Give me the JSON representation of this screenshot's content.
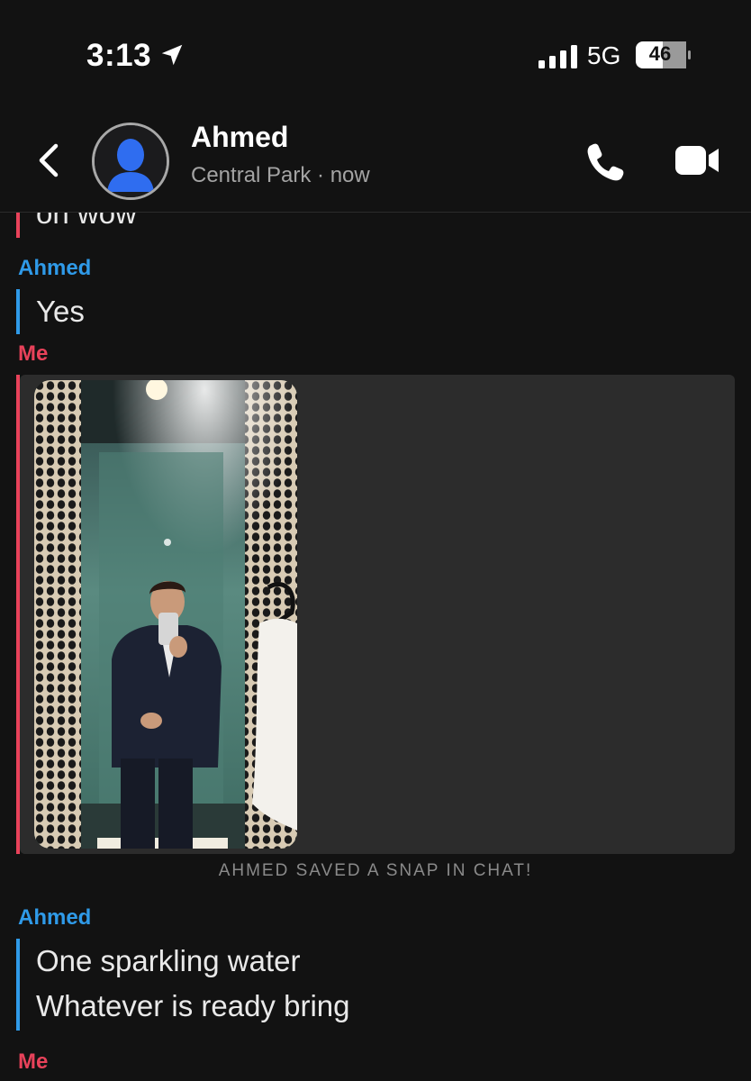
{
  "status_bar": {
    "time": "3:13",
    "network": "5G",
    "battery": "46",
    "location_icon": "location-arrow-icon",
    "signal_icon": "cellular-signal-icon"
  },
  "header": {
    "contact_name": "Ahmed",
    "subtitle": "Central Park · now",
    "back_icon": "chevron-left-icon",
    "call_icon": "phone-icon",
    "video_icon": "video-camera-icon"
  },
  "chat": {
    "partial_message": "oh wow",
    "messages": [
      {
        "sender": "Ahmed",
        "text": "Yes"
      },
      {
        "sender": "Me",
        "type": "snap"
      },
      {
        "system": "AHMED SAVED A SNAP IN CHAT!"
      },
      {
        "sender": "Ahmed",
        "lines": [
          "One sparkling water",
          "Whatever is ready bring"
        ]
      },
      {
        "sender": "Me"
      }
    ]
  },
  "colors": {
    "background": "#121212",
    "me": "#e8425a",
    "them": "#2f9ae8",
    "snap_card": "#2c2c2c"
  }
}
